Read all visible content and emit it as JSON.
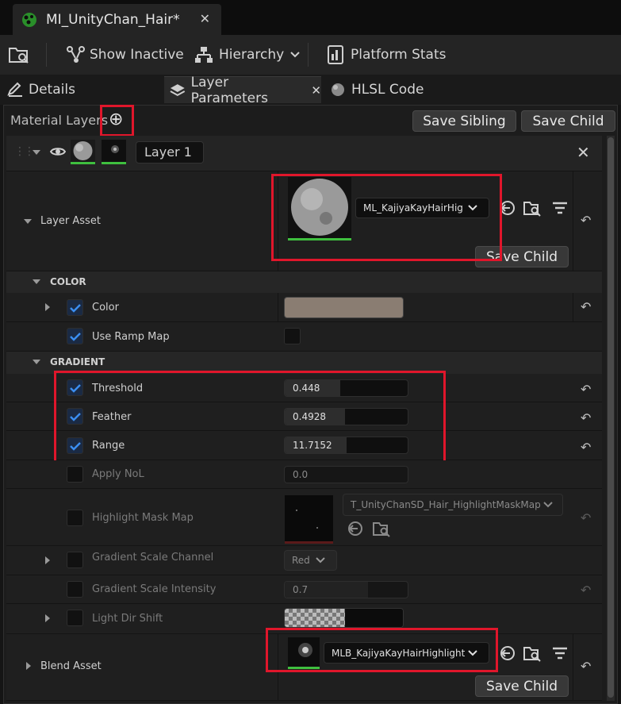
{
  "doc_tab": {
    "title": "MI_UnityChan_Hair*",
    "close": "✕"
  },
  "toolbar": {
    "show_inactive": "Show Inactive",
    "hierarchy": "Hierarchy",
    "platform_stats": "Platform Stats"
  },
  "panel_tabs": {
    "details": "Details",
    "layer_parameters": "Layer Parameters",
    "close": "✕",
    "hlsl": "HLSL Code"
  },
  "material_layers": {
    "title": "Material Layers",
    "save_sibling": "Save Sibling",
    "save_child": "Save Child",
    "add": "⊕"
  },
  "layer": {
    "name": "Layer 1",
    "close": "✕"
  },
  "layer_asset": {
    "label": "Layer Asset",
    "value": "ML_KajiyaKayHairHig",
    "save_child": "Save Child"
  },
  "color_section": {
    "title": "COLOR",
    "color_label": "Color",
    "color_swatch": "#8a7d72",
    "ramp_label": "Use Ramp Map"
  },
  "gradient_section": {
    "title": "GRADIENT",
    "threshold_label": "Threshold",
    "threshold_value": "0.448",
    "threshold_fill": 0.45,
    "feather_label": "Feather",
    "feather_value": "0.4928",
    "feather_fill": 0.49,
    "range_label": "Range",
    "range_value": "11.7152",
    "range_fill": 0.5,
    "apply_nol_label": "Apply NoL",
    "apply_nol_value": "0.0",
    "mask_label": "Highlight Mask Map",
    "mask_value": "T_UnityChanSD_Hair_HighlightMaskMap",
    "scale_channel_label": "Gradient Scale Channel",
    "scale_channel_value": "Red",
    "scale_intensity_label": "Gradient Scale Intensity",
    "scale_intensity_value": "0.7",
    "scale_intensity_fill": 0.7,
    "light_dir_label": "Light Dir Shift"
  },
  "blend_asset": {
    "label": "Blend Asset",
    "value": "MLB_KajiyaKayHairHighlightI",
    "save_child": "Save Child"
  },
  "colors": {
    "accent_green": "#3fbf3f",
    "highlight_red": "#e0162b",
    "checkbox_blue": "#3b8ef0"
  }
}
